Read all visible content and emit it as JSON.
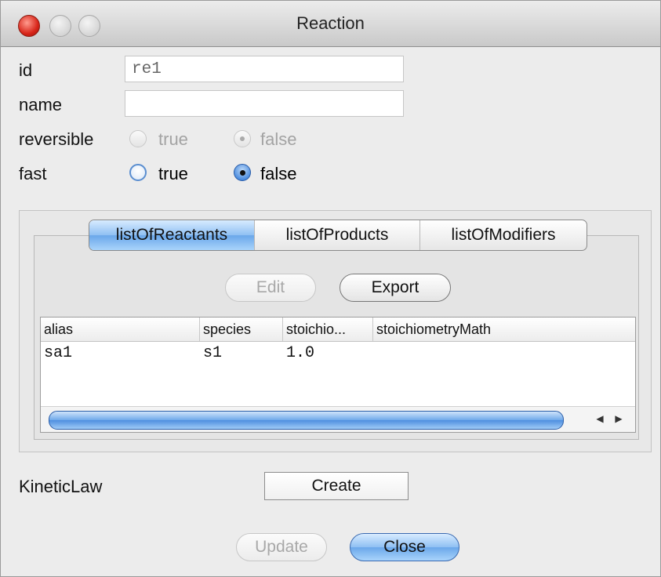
{
  "window": {
    "title": "Reaction"
  },
  "form": {
    "id_label": "id",
    "id_value": "re1",
    "name_label": "name",
    "name_value": "",
    "reversible_label": "reversible",
    "reversible_true": "true",
    "reversible_false": "false",
    "fast_label": "fast",
    "fast_true": "true",
    "fast_false": "false"
  },
  "tabs": [
    {
      "label": "listOfReactants",
      "active": true
    },
    {
      "label": "listOfProducts",
      "active": false
    },
    {
      "label": "listOfModifiers",
      "active": false
    }
  ],
  "toolbar": {
    "edit_label": "Edit",
    "export_label": "Export"
  },
  "table": {
    "columns": [
      "alias",
      "species",
      "stoichio...",
      "stoichiometryMath"
    ],
    "rows": [
      [
        "sa1",
        "s1",
        "1.0",
        ""
      ]
    ]
  },
  "kinetic": {
    "label": "KineticLaw",
    "create_label": "Create"
  },
  "footer": {
    "update_label": "Update",
    "close_label": "Close"
  }
}
